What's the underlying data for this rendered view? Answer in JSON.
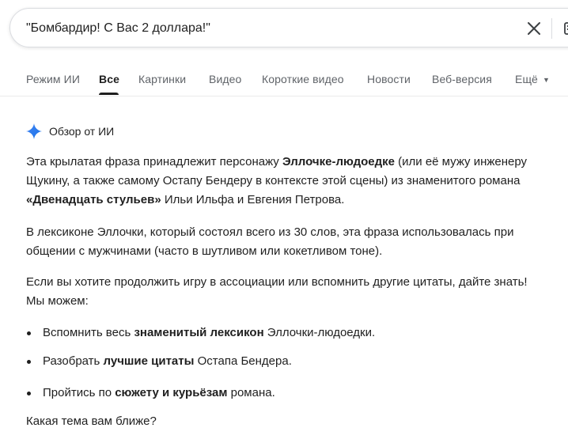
{
  "search": {
    "query": "\"Бомбардир! С Вас 2 доллара!\"",
    "clear_icon": "close-icon",
    "keyboard_icon": "keyboard-icon"
  },
  "tabs": [
    {
      "label": "Режим ИИ",
      "active": false
    },
    {
      "label": "Все",
      "active": true
    },
    {
      "label": "Картинки",
      "active": false
    },
    {
      "label": "Видео",
      "active": false
    },
    {
      "label": "Короткие видео",
      "active": false
    },
    {
      "label": "Новости",
      "active": false
    },
    {
      "label": "Веб-версия",
      "active": false
    },
    {
      "label": "Ещё",
      "active": false
    }
  ],
  "overview": {
    "title": "Обзор от ИИ",
    "icon": "sparkle-icon",
    "paragraph1": {
      "t1": "Эта крылатая фраза принадлежит персонажу ",
      "b1": "Эллочке-людоедке",
      "t2": " (или её мужу инженеру Щукину, а также самому Остапу Бендеру в контексте этой сцены) из знаменитого романа ",
      "b2": "«Двенадцать стульев»",
      "t3": " Ильи Ильфа и Евгения Петрова."
    },
    "paragraph2": "В лексиконе Эллочки, который состоял всего из 30 слов, эта фраза использовалась при общении с мужчинами (часто в шутливом или кокетливом тоне).",
    "paragraph3": "Если вы хотите продолжить игру в ассоциации или вспомнить другие цитаты, дайте знать! Мы можем:",
    "bullets": [
      {
        "t1": "Вспомнить весь ",
        "b": "знаменитый лексикон",
        "t2": " Эллочки-людоедки."
      },
      {
        "t1": "Разобрать ",
        "b": "лучшие цитаты",
        "t2": " Остапа Бендера."
      },
      {
        "t1": "Пройтись по ",
        "b": "сюжету и курьёзам",
        "t2": " романа."
      }
    ],
    "closing": "Какая тема вам ближе?"
  },
  "colors": {
    "text": "#1f1f1f",
    "muted": "#5f6368",
    "sparkle": "#4285f4"
  }
}
